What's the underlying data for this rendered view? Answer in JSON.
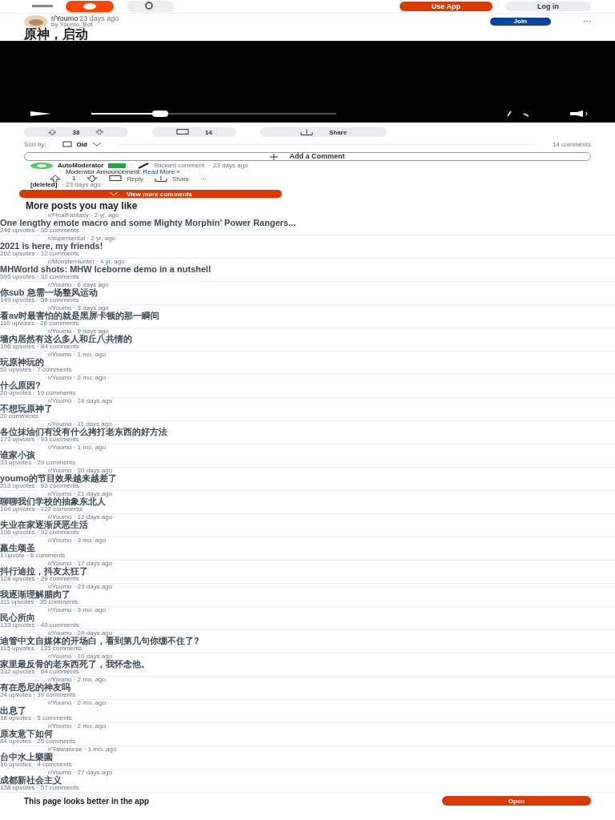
{
  "header": {
    "use_app": "Use App",
    "log_in": "Log in"
  },
  "post": {
    "subreddit": "r/Youmo",
    "age": "23 days ago",
    "author": "by Youmo_Bot",
    "title": "原神，启动",
    "join": "Join",
    "more": "···",
    "video": {
      "level": 0.28
    },
    "votes": "38",
    "comments": "14",
    "share": "Share"
  },
  "sort": {
    "label": "Sort by:",
    "value": "Old",
    "count": "14 comments"
  },
  "add_comment": "Add a Comment",
  "comment": {
    "author": "AutoModerator",
    "sep": "·",
    "stickied": "Stickied comment",
    "age": "· 23 days ago",
    "text": "Moderator Announcement:",
    "link": "Read More »",
    "votes": "1",
    "reply": "Reply",
    "share": "Share",
    "more": "···"
  },
  "deleted": {
    "author": "[deleted]",
    "age": "· 23 days ago"
  },
  "view_more": "View more comments",
  "more_posts": {
    "heading": "More posts you may like",
    "items": [
      {
        "meta": "r/FinalFantasy · 2 yr. ago",
        "title": "One lengthy emote macro and some Mighty Morphin' Power Rangers...",
        "stats": "246 upvotes · 30 comments"
      },
      {
        "meta": "r/supersentai · 2 yr. ago",
        "title": "2021 is here, my friends!",
        "stats": "202 upvotes · 12 comments"
      },
      {
        "meta": "r/MonsterHunter · 4 yr. ago",
        "title": "MHWorld shots: MHW Iceborne demo in a nutshell",
        "stats": "595 upvotes · 32 comments"
      },
      {
        "meta": "r/Youmo · 6 days ago",
        "title": "你sub 急需一场整风运动",
        "stats": "149 upvotes · 59 comments"
      },
      {
        "meta": "r/Youmo · 3 days ago",
        "title": "看av时最害怕的就是黑屏卡顿的那一瞬间",
        "stats": "110 upvotes · 26 comments"
      },
      {
        "meta": "r/Youmo · 9 days ago",
        "title": "墙内居然有这么多人和丘八共情的",
        "stats": "196 upvotes · 84 comments"
      },
      {
        "meta": "r/Youmo · 1 mo. ago",
        "title": "玩原神玩的",
        "stats": "52 upvotes · 7 comments"
      },
      {
        "meta": "r/Youmo · 2 mo. ago",
        "title": "什么原因?",
        "stats": "20 upvotes · 19 comments"
      },
      {
        "meta": "r/Youmo · 24 days ago",
        "title": "不想玩原神了",
        "stats": "20 comments"
      },
      {
        "meta": "r/Youmo · 11 days ago",
        "title": "各位抹油们有没有什么拷打老东西的好方法",
        "stats": "173 upvotes · 93 comments"
      },
      {
        "meta": "r/Youmo · 1 mo. ago",
        "title": "谁家小孩",
        "stats": "33 upvotes · 29 comments"
      },
      {
        "meta": "r/Youmo · 20 days ago",
        "title": "youmo的节目效果越来越差了",
        "stats": "213 upvotes · 83 comments"
      },
      {
        "meta": "r/Youmo · 21 days ago",
        "title": "聊聊我们学校的抽象东北人",
        "stats": "104 upvotes · 122 comments"
      },
      {
        "meta": "r/Youmo · 12 days ago",
        "title": "失业在家逐渐厌恶生活",
        "stats": "106 upvotes · 92 comments"
      },
      {
        "meta": "r/Youmo · 3 mo. ago",
        "title": "羸生颂圣",
        "stats": "1 upvote · 6 comments"
      },
      {
        "meta": "r/Youmo · 17 days ago",
        "title": "抖行迪拉，抖友太狂了",
        "stats": "128 upvotes · 29 comments"
      },
      {
        "meta": "r/Youmo · 23 days ago",
        "title": "我逐渐理解腊肉了",
        "stats": "111 upvotes · 35 comments"
      },
      {
        "meta": "r/Youmo · 3 mo. ago",
        "title": "民心所向",
        "stats": "133 upvotes · 40 comments"
      },
      {
        "meta": "r/Youmo · 24 days ago",
        "title": "迪管中文自媒体的开场白，看到第几句你绷不住了?",
        "stats": "115 upvotes · 135 comments"
      },
      {
        "meta": "r/Youmo · 10 days ago",
        "title": "家里最反骨的老东西死了，我怀念他。",
        "stats": "332 upvotes · 64 comments"
      },
      {
        "meta": "r/Youmo · 2 mo. ago",
        "title": "有在悉尼的神友吗",
        "stats": "24 upvotes · 39 comments"
      },
      {
        "meta": "r/Youmo · 2 mo. ago",
        "title": "出息了",
        "stats": "18 upvotes · 5 comments"
      },
      {
        "meta": "r/Youmo · 2 mo. ago",
        "title": "原友意下如何",
        "stats": "84 upvotes · 25 comments"
      },
      {
        "meta": "r/Taiwanese · 1 mo. ago",
        "title": "台中水上樂園",
        "stats": "10 upvotes · 4 comments"
      },
      {
        "meta": "r/Youmo · 27 days ago",
        "title": "成都新社会主义",
        "stats": "138 upvotes · 57 comments"
      }
    ]
  },
  "footer": {
    "text": "This page looks better in the app",
    "open": "Open"
  }
}
